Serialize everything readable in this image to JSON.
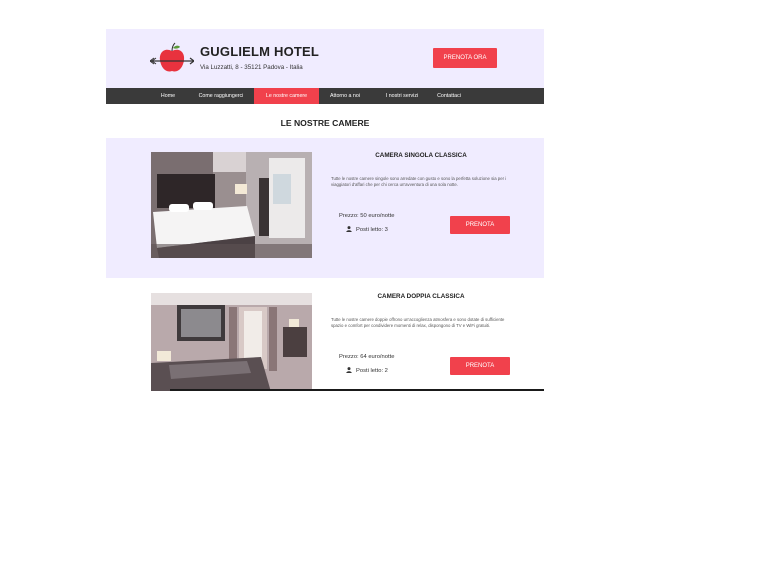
{
  "header": {
    "hotel_name": "GUGLIELM HOTEL",
    "address": "Via Luzzatti, 8 - 35121 Padova - Italia",
    "book_now": "PRENOTA ORA"
  },
  "nav": {
    "items": [
      {
        "label": "Home"
      },
      {
        "label": "Come raggiungerci"
      },
      {
        "label": "Le nostre camere"
      },
      {
        "label": "Attorno a noi"
      },
      {
        "label": "I nostri servizi"
      },
      {
        "label": "Contattaci"
      }
    ],
    "active_index": 2
  },
  "section_title": "LE NOSTRE CAMERE",
  "rooms": [
    {
      "name": "CAMERA SINGOLA CLASSICA",
      "description": "Tutte le nostre camere singole sono arredate con gusto e sono la perfetta soluzione sia per i viaggiatori d'affari che per chi cerca un'avventura di una sola notte.",
      "price": "Prezzo: 50 euro/notte",
      "beds": "Posti letto: 3",
      "book_label": "PRENOTA",
      "photo_icon": "bedroom-photo"
    },
    {
      "name": "CAMERA DOPPIA CLASSICA",
      "description": "Tutte le nostre camere doppie offrono un'accoglienza atmosfera e sono dotate di sufficiente spazio e comfort per condividere momenti di relax, dispongono di TV e WiFi gratuiti.",
      "price": "Prezzo: 64 euro/notte",
      "beds": "Posti letto: 2",
      "book_label": "PRENOTA",
      "photo_icon": "bedroom-photo"
    }
  ],
  "colors": {
    "accent": "#f1414c",
    "header_bg": "#f0ecff",
    "nav_bg": "#3a3a3a"
  }
}
